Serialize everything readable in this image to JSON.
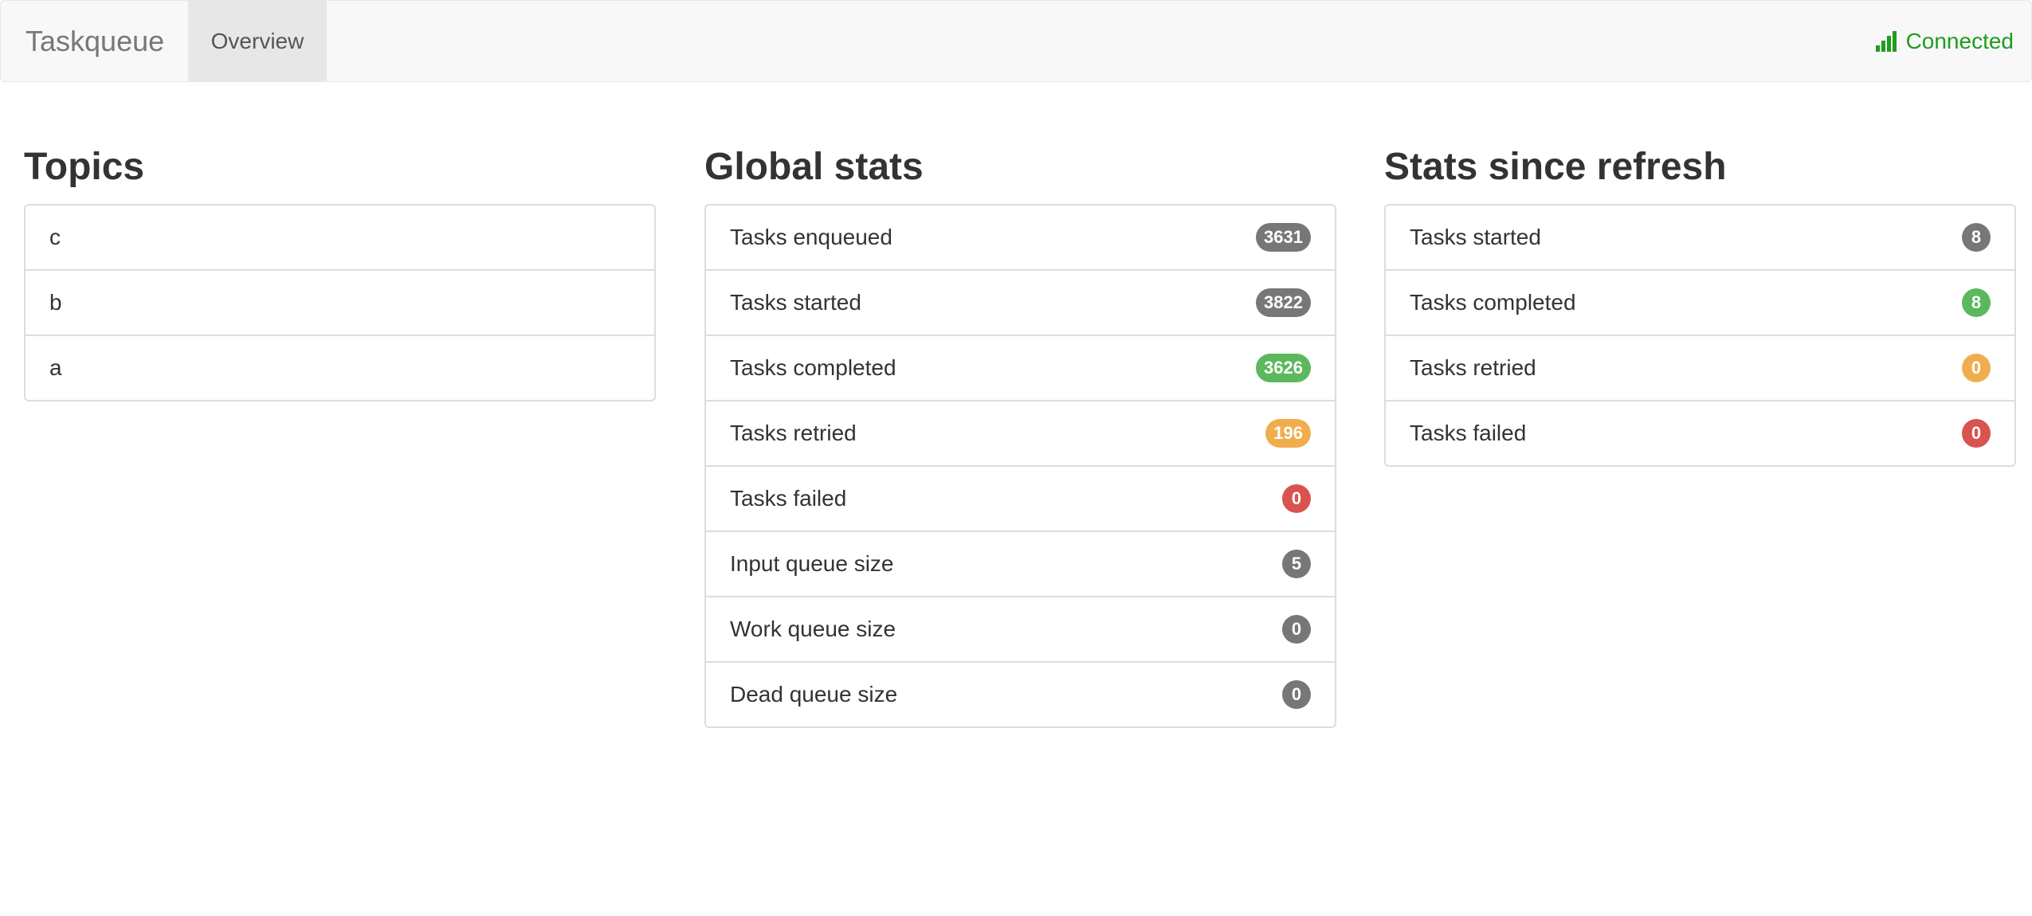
{
  "app": {
    "brand": "Taskqueue",
    "tabs": [
      {
        "label": "Overview",
        "active": true
      }
    ],
    "status": {
      "label": "Connected",
      "icon": "signal-bars-icon",
      "color": "#1e9c1e"
    }
  },
  "colors": {
    "default": "#777777",
    "success": "#5cb85c",
    "warning": "#f0ad4e",
    "danger": "#d9534f"
  },
  "topics": {
    "heading": "Topics",
    "items": [
      "c",
      "b",
      "a"
    ]
  },
  "global_stats": {
    "heading": "Global stats",
    "items": [
      {
        "label": "Tasks enqueued",
        "value": "3631",
        "color": "#777777"
      },
      {
        "label": "Tasks started",
        "value": "3822",
        "color": "#777777"
      },
      {
        "label": "Tasks completed",
        "value": "3626",
        "color": "#5cb85c"
      },
      {
        "label": "Tasks retried",
        "value": "196",
        "color": "#f0ad4e"
      },
      {
        "label": "Tasks failed",
        "value": "0",
        "color": "#d9534f"
      },
      {
        "label": "Input queue size",
        "value": "5",
        "color": "#777777"
      },
      {
        "label": "Work queue size",
        "value": "0",
        "color": "#777777"
      },
      {
        "label": "Dead queue size",
        "value": "0",
        "color": "#777777"
      }
    ]
  },
  "refresh_stats": {
    "heading": "Stats since refresh",
    "items": [
      {
        "label": "Tasks started",
        "value": "8",
        "color": "#777777"
      },
      {
        "label": "Tasks completed",
        "value": "8",
        "color": "#5cb85c"
      },
      {
        "label": "Tasks retried",
        "value": "0",
        "color": "#f0ad4e"
      },
      {
        "label": "Tasks failed",
        "value": "0",
        "color": "#d9534f"
      }
    ]
  }
}
